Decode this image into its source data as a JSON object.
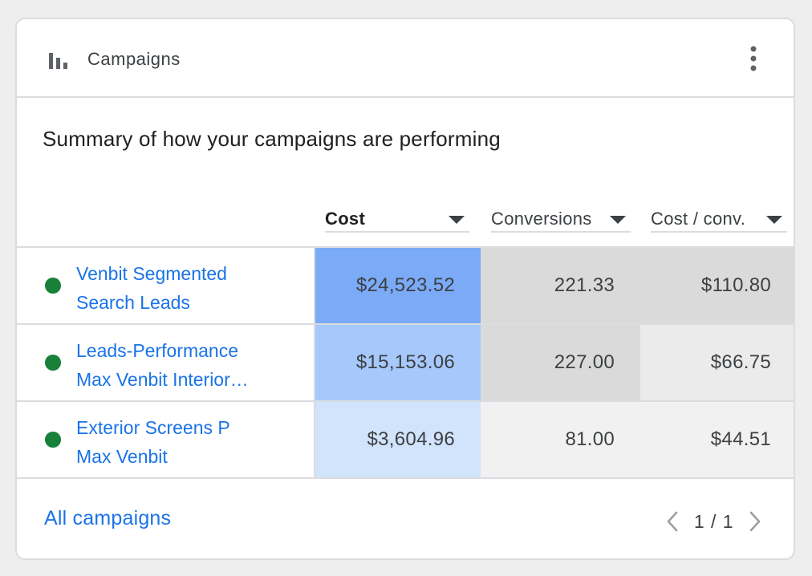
{
  "header": {
    "title": "Campaigns",
    "chart_icon": "bar-chart-icon",
    "more_icon": "more-vert-icon"
  },
  "subtitle": "Summary of how your campaigns are performing",
  "columns": [
    {
      "label": "Cost",
      "sorted": true
    },
    {
      "label": "Conversions",
      "sorted": false
    },
    {
      "label": "Cost / conv.",
      "sorted": false
    }
  ],
  "rows": [
    {
      "name_line1": "Venbit Segmented",
      "name_line2": "Search Leads",
      "status": "enabled",
      "cost": "$24,523.52",
      "conversions": "221.33",
      "cost_per_conv": "$110.80",
      "cost_color": "#7baaf7",
      "conversions_color": "#dadada",
      "cost_per_conv_color": "#dadada"
    },
    {
      "name_line1": "Leads-Performance",
      "name_line2": "Max Venbit Interior…",
      "status": "enabled",
      "cost": "$15,153.06",
      "conversions": "227.00",
      "cost_per_conv": "$66.75",
      "cost_color": "#a6c8fa",
      "conversions_color": "#dadada",
      "cost_per_conv_color": "#ebebeb"
    },
    {
      "name_line1": "Exterior Screens P",
      "name_line2": "Max Venbit",
      "status": "enabled",
      "cost": "$3,604.96",
      "conversions": "81.00",
      "cost_per_conv": "$44.51",
      "cost_color": "#d2e3fc",
      "conversions_color": "#f1f1f1",
      "cost_per_conv_color": "#f1f1f1"
    }
  ],
  "footer": {
    "all_campaigns": "All campaigns",
    "page": "1 / 1",
    "prev_icon": "chevron-left-icon",
    "next_icon": "chevron-right-icon"
  },
  "colors": {
    "link": "#1a73e8",
    "status_enabled": "#188038",
    "divider": "#dadce0"
  }
}
